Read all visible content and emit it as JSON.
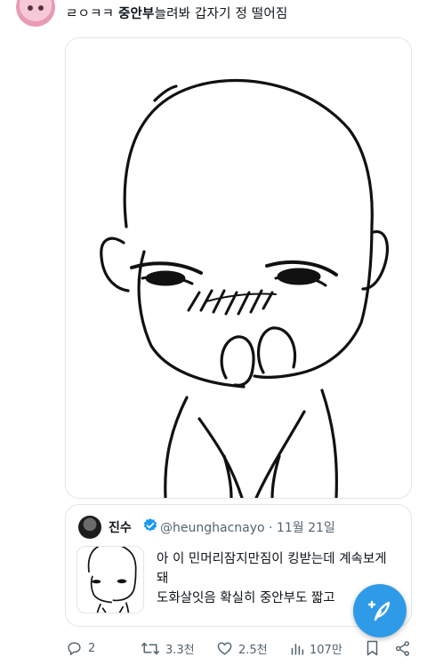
{
  "post": {
    "text_prefix": "ㄹㅇㅋㅋ ",
    "text_bold": "중안부",
    "text_suffix": "늘려봐 갑자기 정 떨어짐"
  },
  "quote": {
    "name": "진수",
    "handle_date": "@heunghacnayo · 11월 21일",
    "line1": "아 이 민머리잠지만짐이 킹받는데 계속보게",
    "line2": "돼",
    "line3": "도화살잇음 확실히 중안부도 짧고"
  },
  "actions": {
    "replies": "2",
    "retweets": "3.3천",
    "likes": "2.5천",
    "views": "107만"
  },
  "colors": {
    "accent": "#2f9be8",
    "verified": "#1d9bf0",
    "muted": "#536471",
    "border": "#e1e6ea"
  },
  "icons": [
    "reply-icon",
    "retweet-icon",
    "like-icon",
    "views-icon",
    "bookmark-icon",
    "share-icon",
    "compose-icon",
    "verified-icon"
  ]
}
